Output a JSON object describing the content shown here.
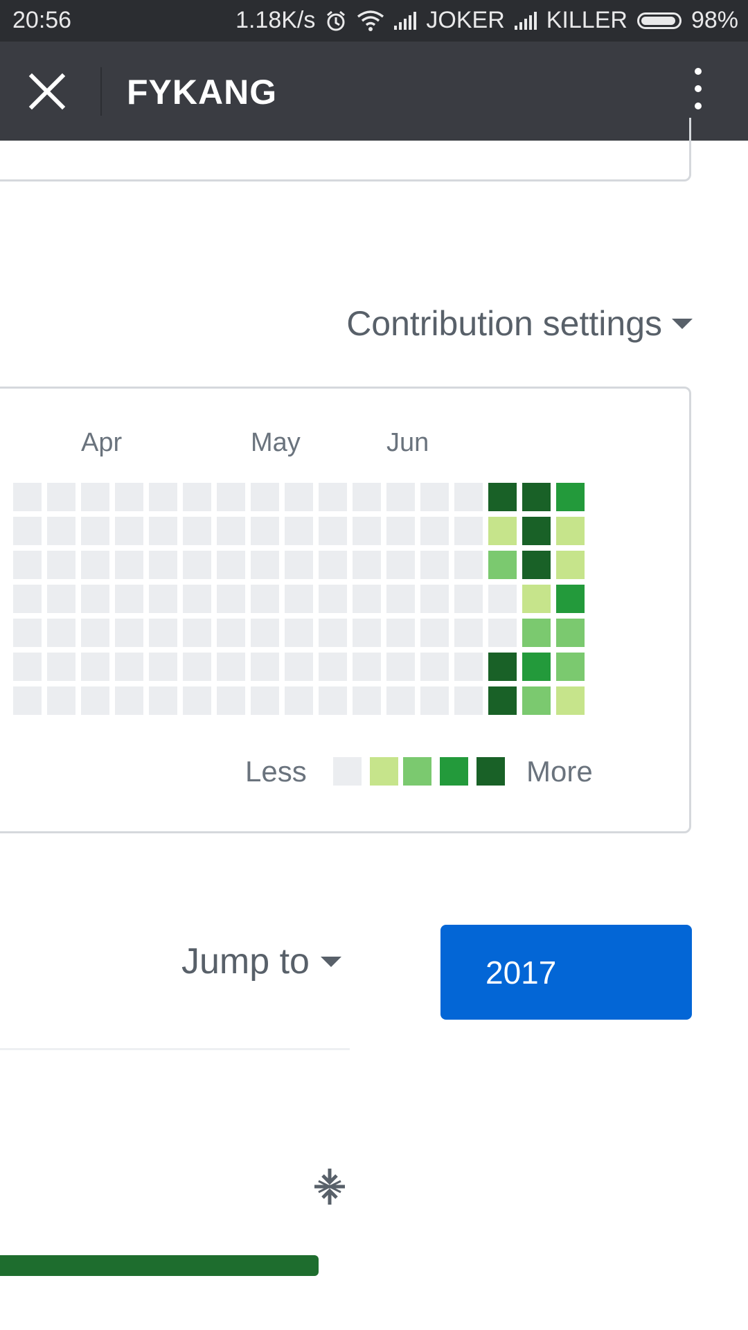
{
  "status_bar": {
    "time": "20:56",
    "speed": "1.18K/s",
    "carrier1": "JOKER",
    "carrier2": "KILLER",
    "battery": "98%",
    "icons": [
      "alarm-icon",
      "wifi-icon",
      "signal-icon",
      "battery-icon"
    ]
  },
  "app_bar": {
    "title": "FYKANG",
    "close_icon": "close-icon",
    "menu_icon": "more-vert-icon"
  },
  "contribution_settings": {
    "label": "Contribution settings"
  },
  "graph": {
    "months": [
      "Apr",
      "May",
      "Jun"
    ],
    "colors": [
      "#ebedf0",
      "#c6e48b",
      "#7bc96f",
      "#239a3b",
      "#196127"
    ],
    "weeks": [
      [
        0,
        0,
        0,
        0,
        0,
        0,
        0
      ],
      [
        0,
        0,
        0,
        0,
        0,
        0,
        0
      ],
      [
        0,
        0,
        0,
        0,
        0,
        0,
        0
      ],
      [
        0,
        0,
        0,
        0,
        0,
        0,
        0
      ],
      [
        0,
        0,
        0,
        0,
        0,
        0,
        0
      ],
      [
        0,
        0,
        0,
        0,
        0,
        0,
        0
      ],
      [
        0,
        0,
        0,
        0,
        0,
        0,
        0
      ],
      [
        0,
        0,
        0,
        0,
        0,
        0,
        0
      ],
      [
        0,
        0,
        0,
        0,
        0,
        0,
        0
      ],
      [
        0,
        0,
        0,
        0,
        0,
        0,
        0
      ],
      [
        0,
        0,
        0,
        0,
        0,
        0,
        0
      ],
      [
        0,
        0,
        0,
        0,
        0,
        0,
        0
      ],
      [
        0,
        0,
        0,
        0,
        0,
        0,
        0
      ],
      [
        0,
        0,
        0,
        0,
        0,
        0,
        0
      ],
      [
        4,
        1,
        2,
        0,
        0,
        4,
        4
      ],
      [
        4,
        4,
        4,
        1,
        2,
        3,
        2
      ],
      [
        3,
        1,
        1,
        3,
        2,
        2,
        1
      ]
    ],
    "legend_less": "Less",
    "legend_more": "More"
  },
  "jump": {
    "label": "Jump to",
    "year": "2017"
  }
}
